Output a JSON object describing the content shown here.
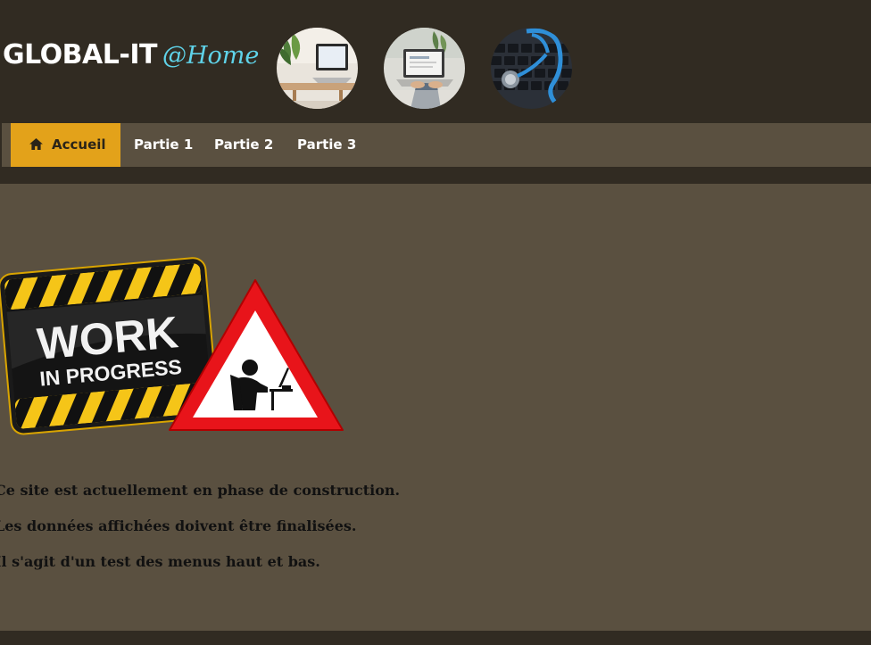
{
  "brand": {
    "name": "GLOBAL-IT",
    "tagline": "@Home"
  },
  "header_thumbnails": [
    {
      "icon": "laptop-desk-photo"
    },
    {
      "icon": "laptop-work-photo"
    },
    {
      "icon": "keyboard-stethoscope-photo"
    }
  ],
  "nav": {
    "items": [
      {
        "label": "Accueil",
        "icon": "home-icon",
        "active": true
      },
      {
        "label": "Partie 1"
      },
      {
        "label": "Partie 2"
      },
      {
        "label": "Partie 3"
      }
    ]
  },
  "main": {
    "banner": {
      "line1": "WORK",
      "line2": "IN PROGRESS"
    },
    "messages": [
      "Ce site est actuellement en phase de construction.",
      "Les données affichées doivent être finalisées.",
      "Il s'agit d'un test des menus haut et bas."
    ]
  },
  "colors": {
    "header_bg": "#312b22",
    "nav_bg": "#5a5040",
    "active_tab": "#e3a21a",
    "accent_cyan": "#5fd3e9"
  }
}
